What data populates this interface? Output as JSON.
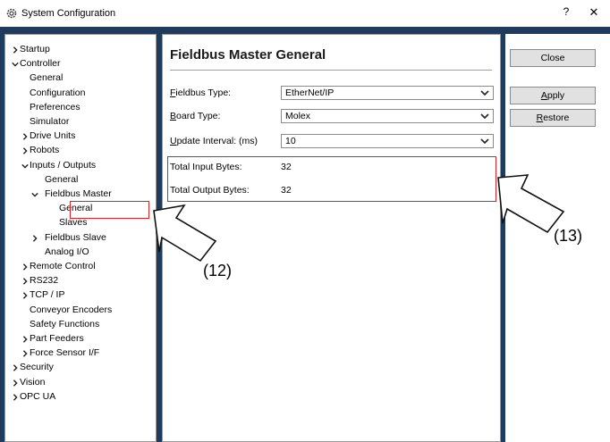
{
  "window": {
    "title": "System Configuration",
    "help_label": "?",
    "close_label": "✕"
  },
  "tree": [
    {
      "label": "Startup",
      "level": 0,
      "chevron": "right"
    },
    {
      "label": "Controller",
      "level": 0,
      "chevron": "down"
    },
    {
      "label": "General",
      "level": 1,
      "chevron": ""
    },
    {
      "label": "Configuration",
      "level": 1,
      "chevron": ""
    },
    {
      "label": "Preferences",
      "level": 1,
      "chevron": ""
    },
    {
      "label": "Simulator",
      "level": 1,
      "chevron": ""
    },
    {
      "label": "Drive Units",
      "level": 1,
      "chevron": "right"
    },
    {
      "label": "Robots",
      "level": 1,
      "chevron": "right"
    },
    {
      "label": "Inputs / Outputs",
      "level": 1,
      "chevron": "down"
    },
    {
      "label": "General",
      "level": 2,
      "chevron": ""
    },
    {
      "label": "Fieldbus Master",
      "level": 2,
      "chevron": "down"
    },
    {
      "label": "General",
      "level": 3,
      "chevron": "",
      "selected": true
    },
    {
      "label": "Slaves",
      "level": 3,
      "chevron": ""
    },
    {
      "label": "Fieldbus Slave",
      "level": 2,
      "chevron": "right"
    },
    {
      "label": "Analog I/O",
      "level": 2,
      "chevron": ""
    },
    {
      "label": "Remote Control",
      "level": 1,
      "chevron": "right"
    },
    {
      "label": "RS232",
      "level": 1,
      "chevron": "right"
    },
    {
      "label": "TCP / IP",
      "level": 1,
      "chevron": "right"
    },
    {
      "label": "Conveyor Encoders",
      "level": 1,
      "chevron": ""
    },
    {
      "label": "Safety Functions",
      "level": 1,
      "chevron": ""
    },
    {
      "label": "Part Feeders",
      "level": 1,
      "chevron": "right"
    },
    {
      "label": "Force Sensor I/F",
      "level": 1,
      "chevron": "right"
    },
    {
      "label": "Security",
      "level": 0,
      "chevron": "right"
    },
    {
      "label": "Vision",
      "level": 0,
      "chevron": "right"
    },
    {
      "label": "OPC UA",
      "level": 0,
      "chevron": "right"
    }
  ],
  "content": {
    "heading": "Fieldbus Master General",
    "fieldbus_type_label_u": "F",
    "fieldbus_type_label_rest": "ieldbus Type:",
    "fieldbus_type_value": "EtherNet/IP",
    "board_type_label_u": "B",
    "board_type_label_rest": "oard Type:",
    "board_type_value": "Molex",
    "update_interval_label_u": "U",
    "update_interval_label_rest": "pdate Interval: (ms)",
    "update_interval_value": "10",
    "total_input_label": "Total Input Bytes:",
    "total_input_value": "32",
    "total_output_label": "Total Output Bytes:",
    "total_output_value": "32"
  },
  "buttons": {
    "close": "Close",
    "apply_u": "A",
    "apply_rest": "pply",
    "restore_u": "R",
    "restore_rest": "estore"
  },
  "annotations": {
    "callout_12": "(12)",
    "callout_13": "(13)",
    "highlight_color": "#e02020"
  }
}
